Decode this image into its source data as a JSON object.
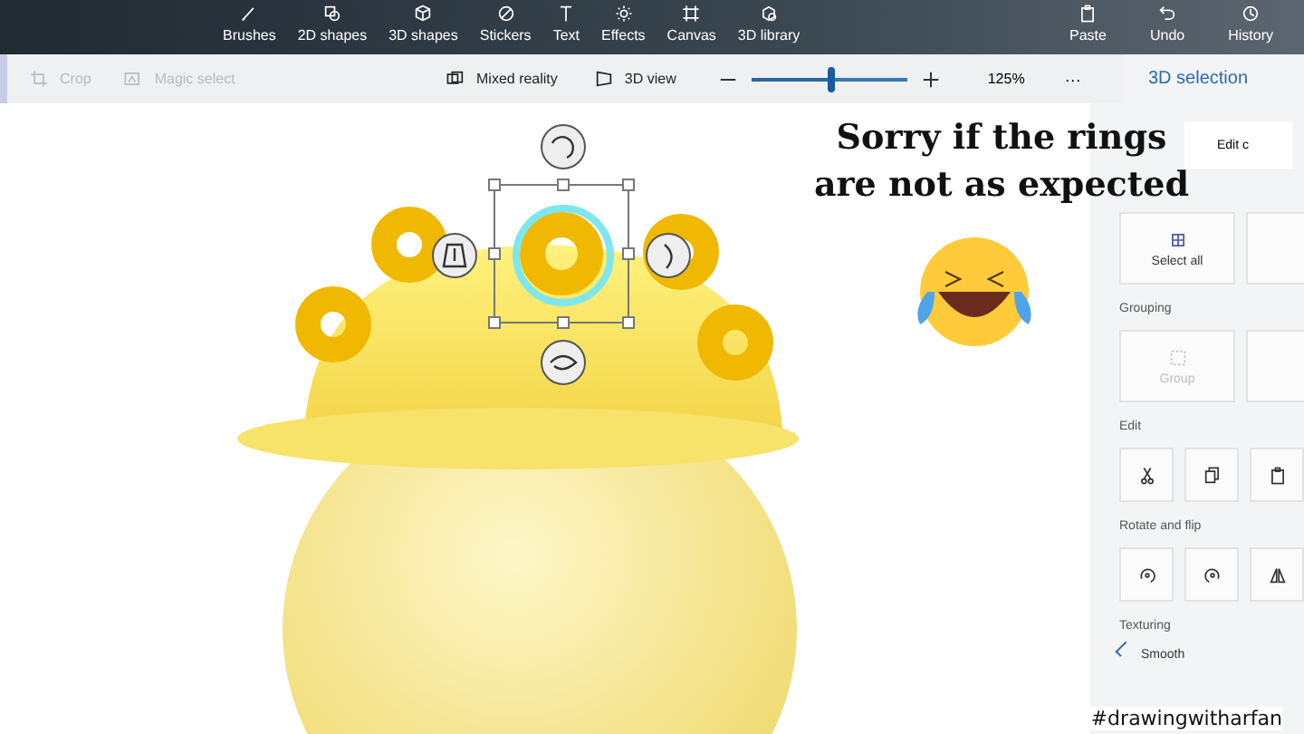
{
  "top_menu": [
    {
      "label": "Brushes"
    },
    {
      "label": "2D shapes"
    },
    {
      "label": "3D shapes"
    },
    {
      "label": "Stickers"
    },
    {
      "label": "Text"
    },
    {
      "label": "Effects"
    },
    {
      "label": "Canvas"
    },
    {
      "label": "3D library"
    }
  ],
  "top_actions": [
    {
      "label": "Paste"
    },
    {
      "label": "Undo"
    },
    {
      "label": "History"
    }
  ],
  "toolbar": {
    "tools": [
      {
        "label": "Crop",
        "disabled": true
      },
      {
        "label": "Magic select",
        "disabled": true
      }
    ],
    "views": [
      {
        "label": "Mixed reality"
      },
      {
        "label": "3D view"
      }
    ],
    "zoom": {
      "level": 0.51,
      "reading": "125%"
    },
    "more": "···"
  },
  "panel": {
    "title": "3D selection",
    "edit_button": "Edit c",
    "select_all": "Select all",
    "sections": [
      {
        "title": "Grouping",
        "buttons": [
          {
            "label": "Group",
            "disabled": true
          }
        ]
      },
      {
        "title": "Edit"
      },
      {
        "title": "Rotate and flip"
      }
    ],
    "texturing": {
      "title": "Texturing",
      "label": "Smooth",
      "checked": true
    }
  },
  "caption": [
    "Sorry if the rings",
    "are not as expected"
  ],
  "hashtag": "#drawingwitharfan"
}
